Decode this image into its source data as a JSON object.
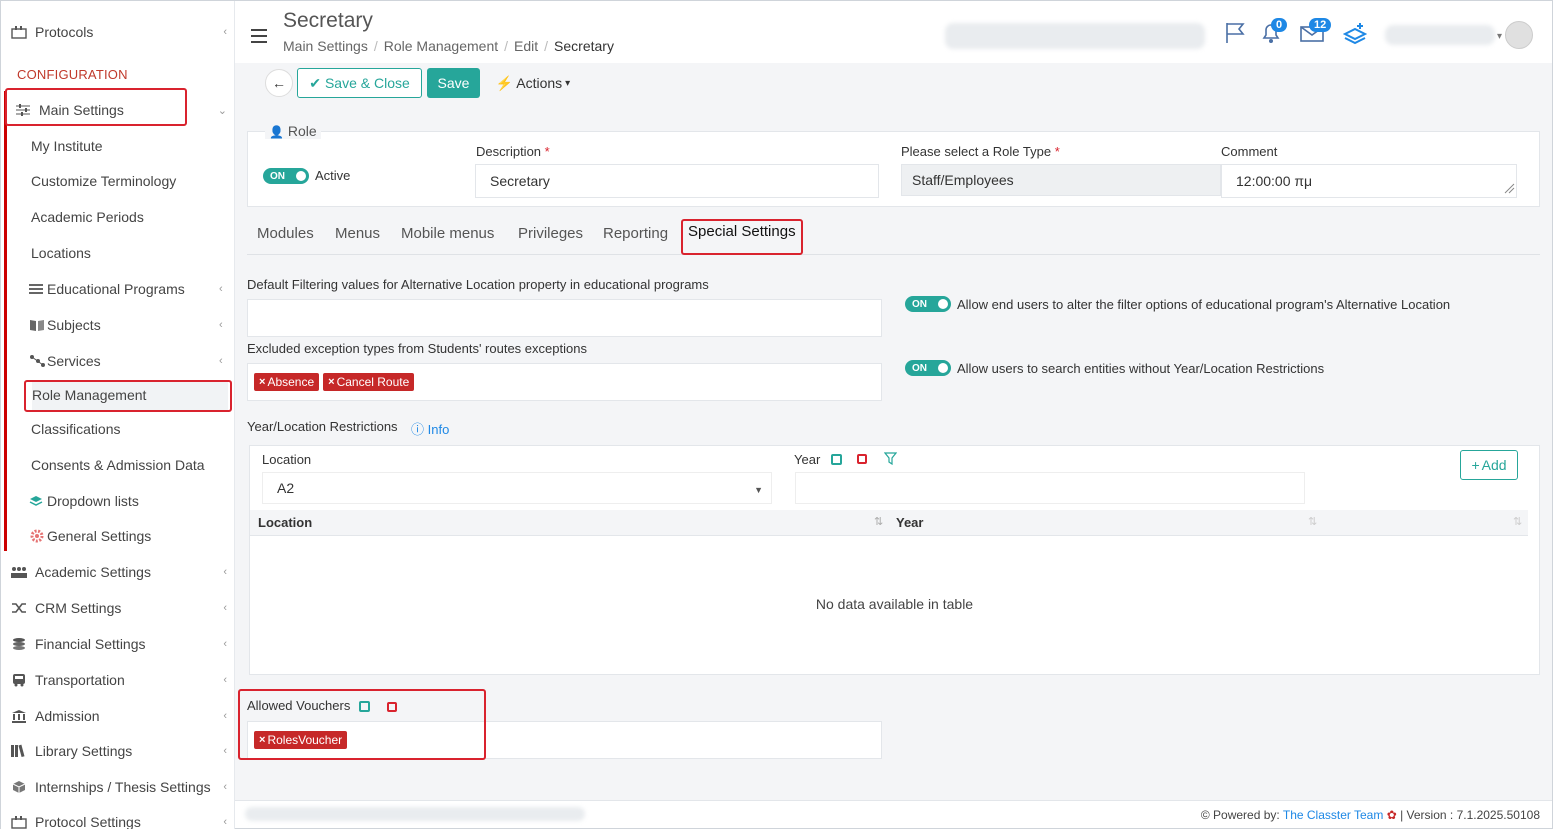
{
  "sidebar": {
    "top_item": "Protocols",
    "section_label": "CONFIGURATION",
    "main_settings": "Main Settings",
    "sub_items": [
      {
        "label": "My Institute"
      },
      {
        "label": "Customize Terminology"
      },
      {
        "label": "Academic Periods"
      },
      {
        "label": "Locations"
      },
      {
        "label": "Educational Programs"
      },
      {
        "label": "Subjects"
      },
      {
        "label": "Services"
      },
      {
        "label": "Role Management"
      },
      {
        "label": "Classifications"
      },
      {
        "label": "Consents & Admission Data"
      },
      {
        "label": "Dropdown lists"
      },
      {
        "label": "General Settings"
      }
    ],
    "groups": [
      {
        "label": "Academic Settings"
      },
      {
        "label": "CRM Settings"
      },
      {
        "label": "Financial Settings"
      },
      {
        "label": "Transportation"
      },
      {
        "label": "Admission"
      },
      {
        "label": "Library Settings"
      },
      {
        "label": "Internships / Thesis Settings"
      },
      {
        "label": "Protocol Settings"
      }
    ]
  },
  "header": {
    "title": "Secretary",
    "breadcrumbs": [
      "Main Settings",
      "Role Management",
      "Edit",
      "Secretary"
    ],
    "notif_count": "0",
    "mail_count": "12"
  },
  "toolbar": {
    "save_close": "Save & Close",
    "save": "Save",
    "actions": "Actions"
  },
  "role": {
    "legend": "Role",
    "toggle_on": "ON",
    "active_label": "Active",
    "description_label": "Description",
    "description_value": "Secretary",
    "role_type_label": "Please select a Role Type",
    "role_type_value": "Staff/Employees",
    "comment_label": "Comment",
    "comment_value": "12:00:00 πμ",
    "required_mark": "*"
  },
  "tabs": [
    "Modules",
    "Menus",
    "Mobile menus",
    "Privileges",
    "Reporting",
    "Special Settings"
  ],
  "special": {
    "default_filter_label": "Default Filtering values for Alternative Location property in educational programs",
    "allow_alter_label": "Allow end users to alter the filter options of educational program's Alternative Location",
    "excluded_label": "Excluded exception types from Students' routes exceptions",
    "excluded_tags": [
      "Absence",
      "Cancel Route"
    ],
    "allow_search_label": "Allow users to search entities without Year/Location Restrictions",
    "restrictions_label": "Year/Location Restrictions",
    "info_label": "Info",
    "location_label": "Location",
    "location_value": "A2",
    "year_label": "Year",
    "add_label": "Add",
    "col_location": "Location",
    "col_year": "Year",
    "no_data": "No data available in table",
    "vouchers_label": "Allowed Vouchers",
    "voucher_tags": [
      "RolesVoucher"
    ]
  },
  "footer": {
    "powered": "Powered by:",
    "team": "The Classter Team",
    "version": "| Version : 7.1.2025.50108"
  }
}
